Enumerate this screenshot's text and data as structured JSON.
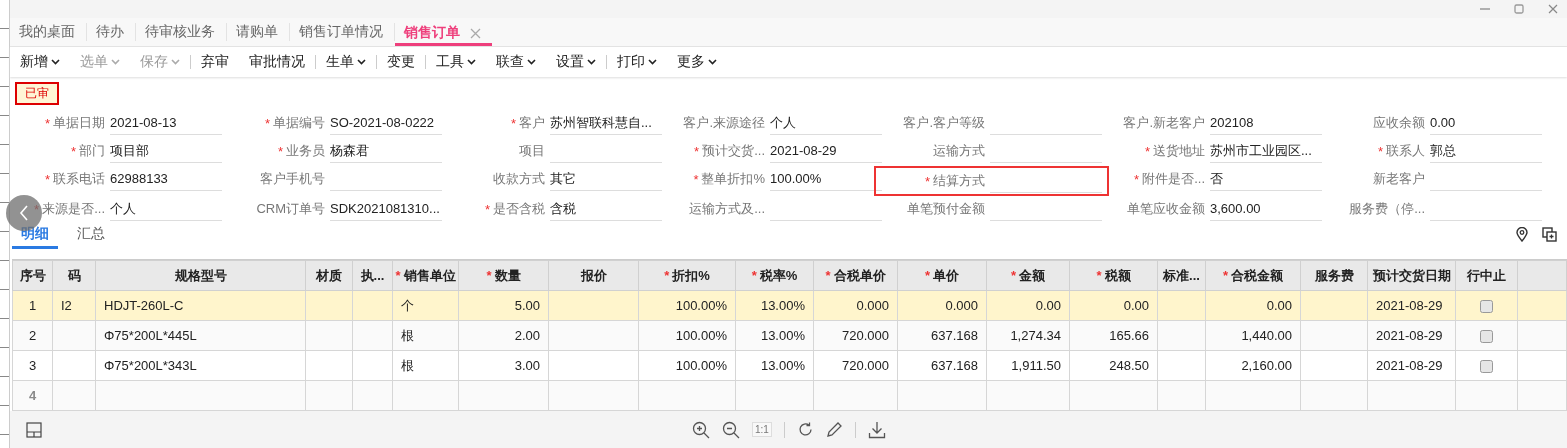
{
  "tabs": [
    {
      "label": "我的桌面",
      "selected": false,
      "closable": false
    },
    {
      "label": "待办",
      "selected": false,
      "closable": false
    },
    {
      "label": "待审核业务",
      "selected": false,
      "closable": false
    },
    {
      "label": "请购单",
      "selected": false,
      "closable": false
    },
    {
      "label": "销售订单情况",
      "selected": false,
      "closable": false
    },
    {
      "label": "销售订单",
      "selected": true,
      "closable": true
    }
  ],
  "toolbar": {
    "groups": [
      [
        {
          "label": "新增",
          "dropdown": true,
          "disabled": false
        },
        {
          "label": "选单",
          "dropdown": true,
          "disabled": true
        },
        {
          "label": "保存",
          "dropdown": true,
          "disabled": true
        }
      ],
      [
        {
          "label": "弃审",
          "dropdown": false,
          "disabled": false
        },
        {
          "label": "审批情况",
          "dropdown": false,
          "disabled": false
        }
      ],
      [
        {
          "label": "生单",
          "dropdown": true,
          "disabled": false
        }
      ],
      [
        {
          "label": "变更",
          "dropdown": false,
          "disabled": false
        }
      ],
      [
        {
          "label": "工具",
          "dropdown": true,
          "disabled": false
        },
        {
          "label": "联查",
          "dropdown": true,
          "disabled": false
        },
        {
          "label": "设置",
          "dropdown": true,
          "disabled": false
        }
      ],
      [
        {
          "label": "打印",
          "dropdown": true,
          "disabled": false
        },
        {
          "label": "更多",
          "dropdown": true,
          "disabled": false
        }
      ]
    ]
  },
  "status_badge": "已审",
  "form": {
    "fields": [
      {
        "label": "单据日期",
        "required_mark": "*",
        "value": "2021-08-13",
        "highlighted": false
      },
      {
        "label": "单据编号",
        "required_mark": "*",
        "value": "SO-2021-08-0222",
        "highlighted": false
      },
      {
        "label": "客户",
        "required_mark": "*",
        "value": "苏州智联科慧自...",
        "highlighted": false
      },
      {
        "label": "客户.来源途径",
        "value": "个人",
        "highlighted": false
      },
      {
        "label": "客户.客户等级",
        "highlighted": false
      },
      {
        "label": "客户.新老客户",
        "value": "202108",
        "highlighted": false
      },
      {
        "label": "应收余额",
        "value": "0.00",
        "highlighted": false
      },
      {
        "label": "部门",
        "required_mark": "*",
        "value": "项目部",
        "highlighted": false
      },
      {
        "label": "业务员",
        "required_mark": "*",
        "value": "杨森君",
        "highlighted": false
      },
      {
        "label": "项目",
        "highlighted": false
      },
      {
        "label": "预计交货...",
        "required_mark": "*",
        "value": "2021-08-29",
        "highlighted": false
      },
      {
        "label": "运输方式",
        "highlighted": false
      },
      {
        "label": "送货地址",
        "required_mark": "*",
        "value": "苏州市工业园区...",
        "highlighted": false
      },
      {
        "label": "联系人",
        "required_mark": "*",
        "value": "郭总",
        "highlighted": false
      },
      {
        "label": "联系电话",
        "required_mark": "*",
        "value": "62988133",
        "highlighted": false
      },
      {
        "label": "客户手机号",
        "highlighted": false
      },
      {
        "label": "收款方式",
        "value": "其它",
        "highlighted": false
      },
      {
        "label": "整单折扣%",
        "required_mark": "*",
        "value": "100.00%",
        "highlighted": false
      },
      {
        "label": "结算方式",
        "required_mark": "*",
        "highlighted": true
      },
      {
        "label": "附件是否...",
        "required_mark": "*",
        "value": "否",
        "highlighted": false
      },
      {
        "label": "新老客户",
        "highlighted": false
      },
      {
        "label": "来源是否...",
        "required_mark": "*",
        "value": "个人",
        "highlighted": false
      },
      {
        "label": "CRM订单号",
        "value": "SDK2021081310...",
        "highlighted": false
      },
      {
        "label": "是否含税",
        "required_mark": "*",
        "value": "含税",
        "highlighted": false
      },
      {
        "label": "运输方式及...",
        "highlighted": false
      },
      {
        "label": "单笔预付金额",
        "highlighted": false
      },
      {
        "label": "单笔应收金额",
        "value": "3,600.00",
        "highlighted": false
      },
      {
        "label": "服务费（停...",
        "highlighted": false
      }
    ]
  },
  "detail_tabs": [
    {
      "label": "明细",
      "selected": true
    },
    {
      "label": "汇总",
      "selected": false
    }
  ],
  "table": {
    "columns": [
      {
        "label": "序号",
        "kind": "index"
      },
      {
        "label": "码",
        "kind": "text"
      },
      {
        "label": "规格型号",
        "kind": "text"
      },
      {
        "label": "材质",
        "kind": "text"
      },
      {
        "label": "执...",
        "kind": "text"
      },
      {
        "label": "销售单位",
        "kind": "text",
        "required_mark": "*"
      },
      {
        "label": "数量",
        "kind": "number",
        "required_mark": "*"
      },
      {
        "label": "报价",
        "kind": "number"
      },
      {
        "label": "折扣%",
        "kind": "number",
        "required_mark": "*"
      },
      {
        "label": "税率%",
        "kind": "number",
        "required_mark": "*"
      },
      {
        "label": "合税单价",
        "kind": "number",
        "required_mark": "*"
      },
      {
        "label": "单价",
        "kind": "number",
        "required_mark": "*"
      },
      {
        "label": "金额",
        "kind": "number",
        "required_mark": "*"
      },
      {
        "label": "税额",
        "kind": "number",
        "required_mark": "*"
      },
      {
        "label": "标准...",
        "kind": "text"
      },
      {
        "label": "合税金额",
        "kind": "number",
        "required_mark": "*"
      },
      {
        "label": "服务费",
        "kind": "text"
      },
      {
        "label": "预计交货日期",
        "kind": "text"
      },
      {
        "label": "行中止",
        "kind": "check"
      }
    ],
    "rows": [
      {
        "index": "1",
        "selected": true,
        "blank": false,
        "stopped": false,
        "cells": [
          "I2",
          "HDJT-260L-C",
          null,
          null,
          "个",
          "5.00",
          null,
          "100.00%",
          "13.00%",
          "0.000",
          "0.000",
          "0.00",
          "0.00",
          null,
          "0.00",
          null,
          "2021-08-29"
        ]
      },
      {
        "index": "2",
        "selected": false,
        "blank": false,
        "stopped": false,
        "cells": [
          null,
          "Φ75*200L*445L",
          null,
          null,
          "根",
          "2.00",
          null,
          "100.00%",
          "13.00%",
          "720.000",
          "637.168",
          "1,274.34",
          "165.66",
          null,
          "1,440.00",
          null,
          "2021-08-29"
        ]
      },
      {
        "index": "3",
        "selected": false,
        "blank": false,
        "stopped": false,
        "cells": [
          null,
          "Φ75*200L*343L",
          null,
          null,
          "根",
          "3.00",
          null,
          "100.00%",
          "13.00%",
          "720.000",
          "637.168",
          "1,911.50",
          "248.50",
          null,
          "2,160.00",
          null,
          "2021-08-29"
        ]
      },
      {
        "index": "4",
        "selected": false,
        "blank": true
      }
    ]
  },
  "bottom_toolbar": {
    "actual_size": "1:1"
  }
}
